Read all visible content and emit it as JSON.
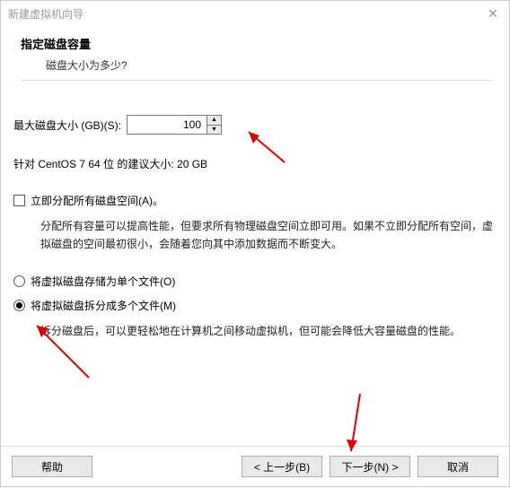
{
  "titlebar": {
    "title": "新建虚拟机向导"
  },
  "header": {
    "title": "指定磁盘容量",
    "subtitle": "磁盘大小为多少?"
  },
  "disk": {
    "size_label": "最大磁盘大小 (GB)(S):",
    "size_value": "100",
    "recommendation": "针对 CentOS 7 64 位 的建议大小: 20 GB"
  },
  "allocate": {
    "checkbox_label": "立即分配所有磁盘空间(A)。",
    "description": "分配所有容量可以提高性能，但要求所有物理磁盘空间立即可用。如果不立即分配所有空间，虚拟磁盘的空间最初很小，会随着您向其中添加数据而不断变大。"
  },
  "storage": {
    "single_label": "将虚拟磁盘存储为单个文件(O)",
    "split_label": "将虚拟磁盘拆分成多个文件(M)",
    "split_description": "拆分磁盘后，可以更轻松地在计算机之间移动虚拟机，但可能会降低大容量磁盘的性能。"
  },
  "buttons": {
    "help": "帮助",
    "back": "< 上一步(B)",
    "next": "下一步(N) >",
    "cancel": "取消"
  }
}
